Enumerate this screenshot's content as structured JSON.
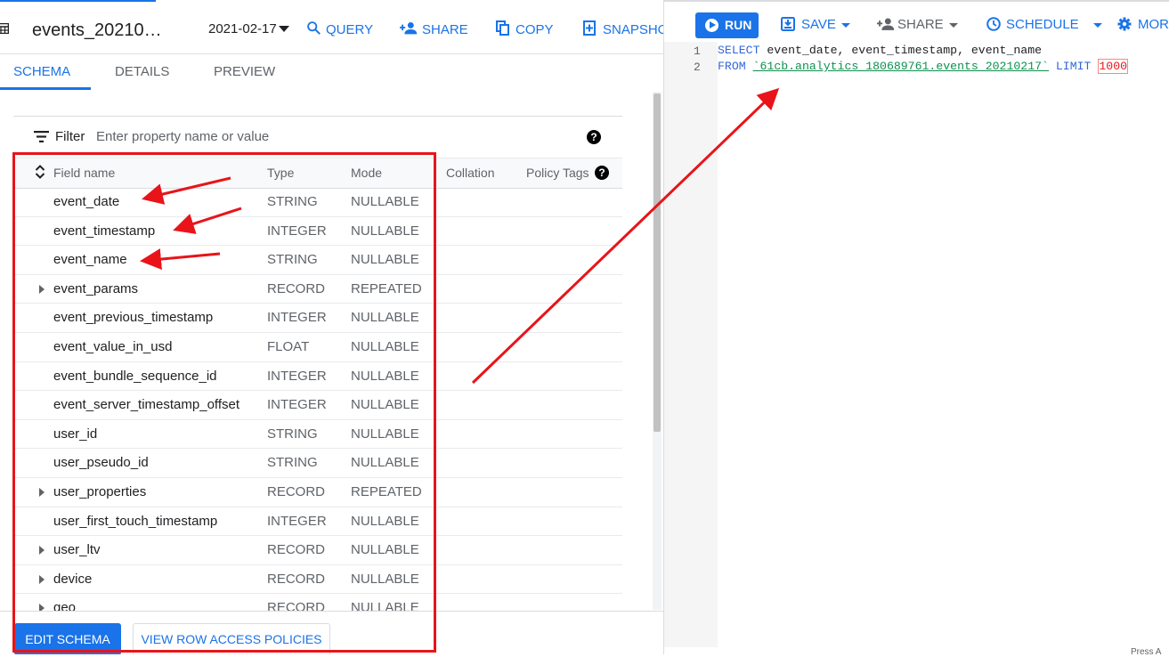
{
  "left_panel": {
    "title": "events_20210…",
    "date": "2021-02-17",
    "toolbar": {
      "query": "QUERY",
      "share": "SHARE",
      "copy": "COPY",
      "snapshot": "SNAPSHO"
    },
    "tabs": [
      "SCHEMA",
      "DETAILS",
      "PREVIEW"
    ],
    "active_tab": "SCHEMA",
    "filter": {
      "label": "Filter",
      "placeholder": "Enter property name or value"
    },
    "columns": [
      "Field name",
      "Type",
      "Mode",
      "Collation",
      "Policy Tags"
    ],
    "fields": [
      {
        "name": "event_date",
        "type": "STRING",
        "mode": "NULLABLE",
        "expandable": false
      },
      {
        "name": "event_timestamp",
        "type": "INTEGER",
        "mode": "NULLABLE",
        "expandable": false
      },
      {
        "name": "event_name",
        "type": "STRING",
        "mode": "NULLABLE",
        "expandable": false
      },
      {
        "name": "event_params",
        "type": "RECORD",
        "mode": "REPEATED",
        "expandable": true
      },
      {
        "name": "event_previous_timestamp",
        "type": "INTEGER",
        "mode": "NULLABLE",
        "expandable": false
      },
      {
        "name": "event_value_in_usd",
        "type": "FLOAT",
        "mode": "NULLABLE",
        "expandable": false
      },
      {
        "name": "event_bundle_sequence_id",
        "type": "INTEGER",
        "mode": "NULLABLE",
        "expandable": false
      },
      {
        "name": "event_server_timestamp_offset",
        "type": "INTEGER",
        "mode": "NULLABLE",
        "expandable": false
      },
      {
        "name": "user_id",
        "type": "STRING",
        "mode": "NULLABLE",
        "expandable": false
      },
      {
        "name": "user_pseudo_id",
        "type": "STRING",
        "mode": "NULLABLE",
        "expandable": false
      },
      {
        "name": "user_properties",
        "type": "RECORD",
        "mode": "REPEATED",
        "expandable": true
      },
      {
        "name": "user_first_touch_timestamp",
        "type": "INTEGER",
        "mode": "NULLABLE",
        "expandable": false
      },
      {
        "name": "user_ltv",
        "type": "RECORD",
        "mode": "NULLABLE",
        "expandable": true
      },
      {
        "name": "device",
        "type": "RECORD",
        "mode": "NULLABLE",
        "expandable": true
      },
      {
        "name": "geo",
        "type": "RECORD",
        "mode": "NULLABLE",
        "expandable": true
      }
    ],
    "buttons": {
      "edit_schema": "EDIT SCHEMA",
      "view_row_access": "VIEW ROW ACCESS POLICIES"
    }
  },
  "right_panel": {
    "toolbar": {
      "run": "RUN",
      "save": "SAVE",
      "share": "SHARE",
      "schedule": "SCHEDULE",
      "more": "MORE"
    },
    "editor": {
      "line_numbers": [
        "1",
        "2"
      ],
      "line1": {
        "kw": "SELECT",
        "rest": " event_date, event_timestamp, event_name"
      },
      "line2": {
        "kw": "FROM",
        "table": "`61cb.analytics_180689761.events_20210217`",
        "kw2": "LIMIT",
        "limit": "1000"
      }
    },
    "footer_hint": "Press A"
  },
  "colors": {
    "accent": "#1a73e8",
    "annotation_red": "#e8141a",
    "keyword": "#3367d6",
    "table_ref": "#0d904f"
  }
}
